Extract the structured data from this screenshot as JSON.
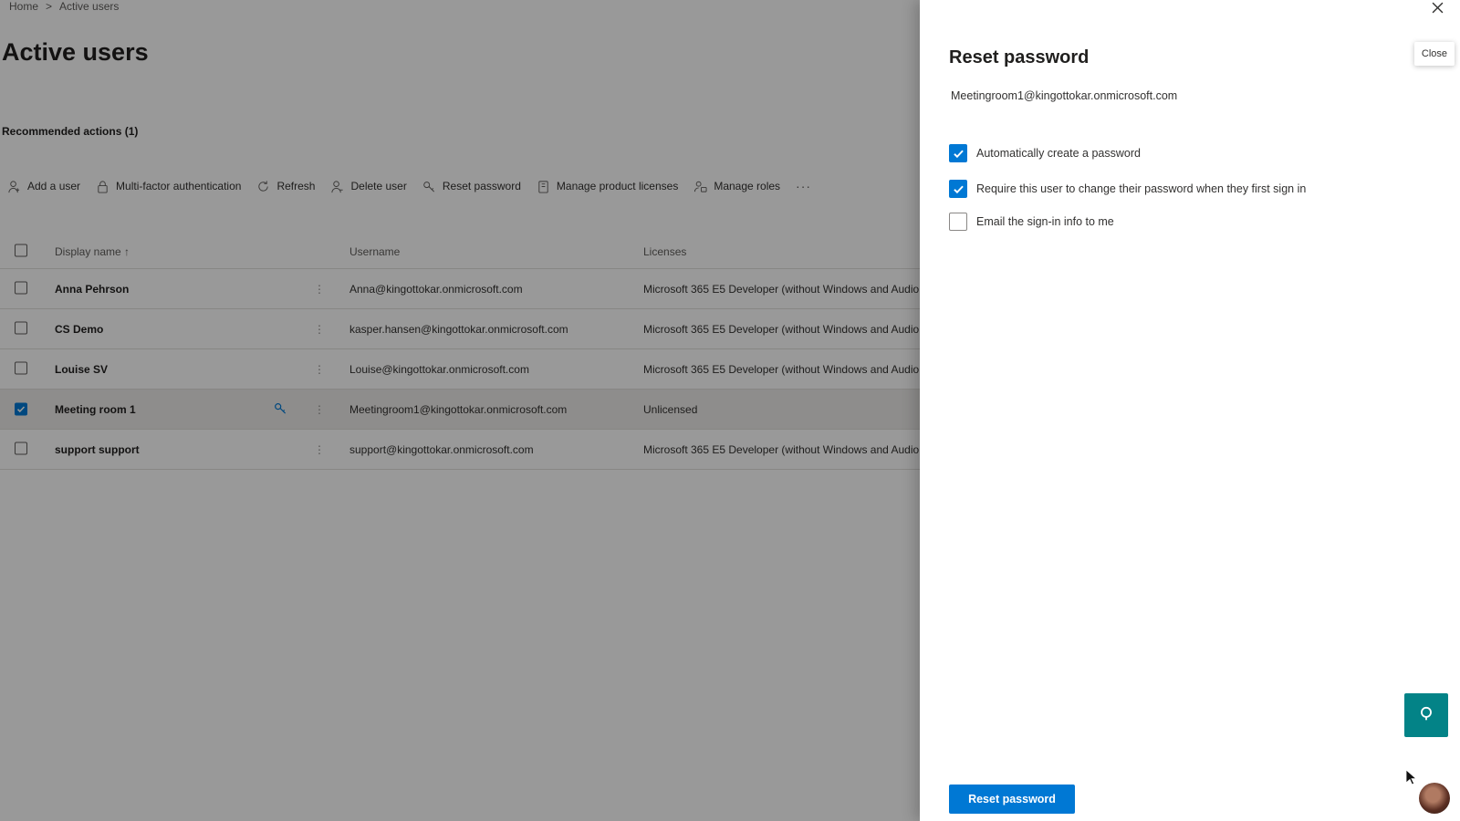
{
  "breadcrumb": {
    "home": "Home",
    "separator": ">",
    "current": "Active users"
  },
  "page": {
    "title": "Active users",
    "recommended": "Recommended actions (1)"
  },
  "toolbar": {
    "items": [
      {
        "label": "Add a user",
        "icon": "person-add-icon"
      },
      {
        "label": "Multi-factor authentication",
        "icon": "lock-icon"
      },
      {
        "label": "Refresh",
        "icon": "refresh-icon"
      },
      {
        "label": "Delete user",
        "icon": "person-delete-icon"
      },
      {
        "label": "Reset password",
        "icon": "key-icon"
      },
      {
        "label": "Manage product licenses",
        "icon": "license-icon"
      },
      {
        "label": "Manage roles",
        "icon": "roles-icon"
      }
    ],
    "more": "···"
  },
  "grid": {
    "columns": {
      "name": "Display name ↑",
      "username": "Username",
      "licenses": "Licenses"
    },
    "rows": [
      {
        "name": "Anna Pehrson",
        "username": "Anna@kingottokar.onmicrosoft.com",
        "licenses": "Microsoft 365 E5 Developer (without Windows and Audio",
        "selected": false
      },
      {
        "name": "CS Demo",
        "username": "kasper.hansen@kingottokar.onmicrosoft.com",
        "licenses": "Microsoft 365 E5 Developer (without Windows and Audio",
        "selected": false
      },
      {
        "name": "Louise SV",
        "username": "Louise@kingottokar.onmicrosoft.com",
        "licenses": "Microsoft 365 E5 Developer (without Windows and Audio",
        "selected": false
      },
      {
        "name": "Meeting room 1",
        "username": "Meetingroom1@kingottokar.onmicrosoft.com",
        "licenses": "Unlicensed",
        "selected": true
      },
      {
        "name": "support support",
        "username": "support@kingottokar.onmicrosoft.com",
        "licenses": "Microsoft 365 E5 Developer (without Windows and Audio",
        "selected": false
      }
    ]
  },
  "panel": {
    "title": "Reset password",
    "email": "Meetingroom1@kingottokar.onmicrosoft.com",
    "close_tooltip": "Close",
    "options": {
      "auto_create": {
        "label": "Automatically create a password",
        "checked": true
      },
      "require_change": {
        "label": "Require this user to change their password when they first sign in",
        "checked": true
      },
      "email_info": {
        "label": "Email the sign-in info to me",
        "checked": false
      }
    },
    "primary_button": "Reset password"
  },
  "colors": {
    "accent": "#0078d4",
    "fab": "#038387",
    "overlay": "rgba(0,0,0,0.4)"
  }
}
